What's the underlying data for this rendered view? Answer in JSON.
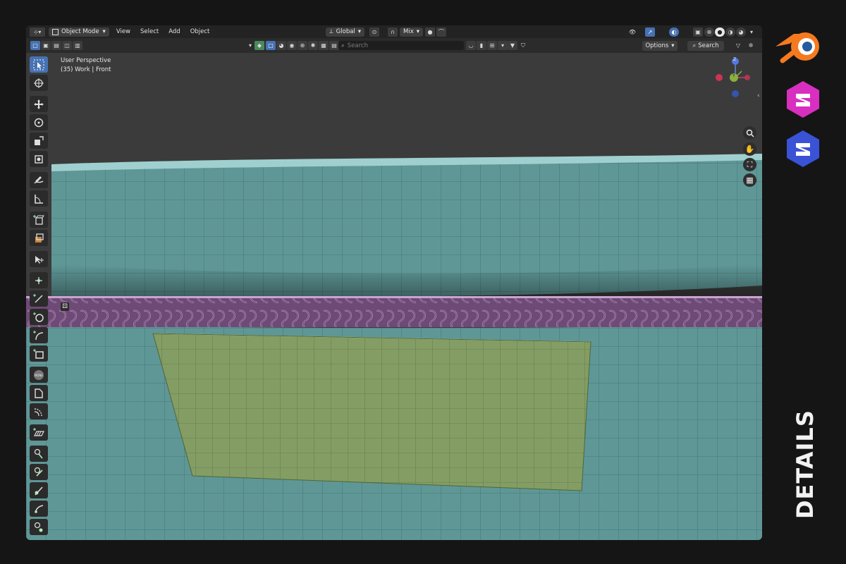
{
  "header": {
    "mode": "Object Mode",
    "menus": [
      "View",
      "Select",
      "Add",
      "Object"
    ],
    "transform_orientation": "Global",
    "pivot_label": "Mix"
  },
  "header2": {
    "search_placeholder": "Search",
    "options_label": "Options",
    "search_button": "Search"
  },
  "viewport": {
    "view_name": "User Perspective",
    "collection_info": "(35) Work | Front"
  },
  "gizmo": {
    "z_label": "Z",
    "y_label": "Y"
  },
  "side_label": "DETAILS",
  "colors": {
    "cloth": "#5f9797",
    "patch": "#849d64",
    "stitch": "#8a5a90",
    "accent": "#4772b3"
  }
}
